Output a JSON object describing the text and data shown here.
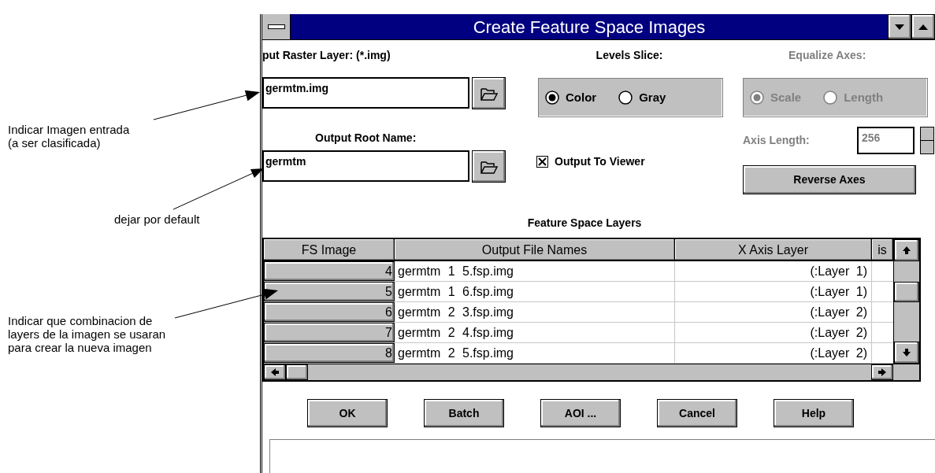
{
  "window": {
    "title": "Create Feature Space Images"
  },
  "input_raster": {
    "label": "put Raster Layer: (*.img)",
    "value": "germtm.img"
  },
  "levels_slice": {
    "label": "Levels Slice:",
    "disabled": false,
    "options": [
      {
        "label": "Color",
        "selected": true
      },
      {
        "label": "Gray",
        "selected": false
      }
    ]
  },
  "equalize_axes": {
    "label": "Equalize Axes:",
    "disabled": true,
    "options": [
      {
        "label": "Scale",
        "selected": true
      },
      {
        "label": "Length",
        "selected": false
      }
    ]
  },
  "output_root": {
    "label": "Output Root Name:",
    "value": "germtm"
  },
  "output_to_viewer": {
    "label": "Output To Viewer",
    "checked": true
  },
  "axis_length": {
    "label": "Axis Length:",
    "value": "256",
    "disabled": true
  },
  "reverse_axes": "Reverse Axes",
  "table": {
    "title": "Feature Space Layers",
    "columns": [
      "FS Image",
      "Output File Names",
      "X Axis Layer",
      "is"
    ],
    "rows": [
      {
        "fs_image": "4",
        "file": "germtm 1 5.fsp.img",
        "x_axis": "(:Layer 1)"
      },
      {
        "fs_image": "5",
        "file": "germtm 1 6.fsp.img",
        "x_axis": "(:Layer 1)"
      },
      {
        "fs_image": "6",
        "file": "germtm 2 3.fsp.img",
        "x_axis": "(:Layer 2)"
      },
      {
        "fs_image": "7",
        "file": "germtm 2 4.fsp.img",
        "x_axis": "(:Layer 2)"
      },
      {
        "fs_image": "8",
        "file": "germtm 2 5.fsp.img",
        "x_axis": "(:Layer 2)"
      }
    ]
  },
  "buttons": [
    "OK",
    "Batch",
    "AOI ...",
    "Cancel",
    "Help"
  ],
  "annotations": [
    {
      "lines": [
        "Indicar Imagen entrada",
        "(a ser clasificada)"
      ]
    },
    {
      "lines": [
        "dejar por default"
      ]
    },
    {
      "lines": [
        "Indicar que combinacion de",
        "layers de la imagen se usaran",
        "para crear la nueva imagen"
      ]
    }
  ]
}
